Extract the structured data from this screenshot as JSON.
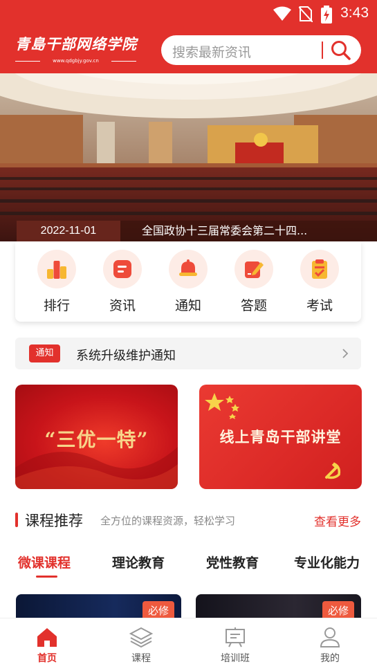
{
  "status_bar": {
    "time": "3:43"
  },
  "header": {
    "logo_title": "青島干部网络学院",
    "logo_url": "www.qdgbjy.gov.cn",
    "search_placeholder": "搜索最新资讯"
  },
  "banner": {
    "date": "2022-11-01",
    "title": "全国政协十三届常委会第二十四..."
  },
  "quick_menu": [
    {
      "label": "排行",
      "icon": "ranking-icon"
    },
    {
      "label": "资讯",
      "icon": "news-icon"
    },
    {
      "label": "通知",
      "icon": "bell-icon"
    },
    {
      "label": "答题",
      "icon": "quiz-icon"
    },
    {
      "label": "考试",
      "icon": "exam-icon"
    }
  ],
  "notice": {
    "tag": "通知",
    "text": "系统升级维护通知"
  },
  "promos": [
    {
      "text": "“三优一特”"
    },
    {
      "text": "线上青岛干部讲堂"
    }
  ],
  "courses": {
    "title": "课程推荐",
    "subtitle": "全方位的课程资源，轻松学习",
    "more": "查看更多",
    "tabs": [
      "微课课程",
      "理论教育",
      "党性教育",
      "专业化能力"
    ],
    "active_tab": 0,
    "cards": [
      {
        "badge": "必修"
      },
      {
        "badge": "必修"
      }
    ]
  },
  "bottom_nav": [
    {
      "label": "首页",
      "active": true
    },
    {
      "label": "课程",
      "active": false
    },
    {
      "label": "培训班",
      "active": false
    },
    {
      "label": "我的",
      "active": false
    }
  ],
  "colors": {
    "brand_red": "#e2312c",
    "gold": "#f7d58a"
  }
}
